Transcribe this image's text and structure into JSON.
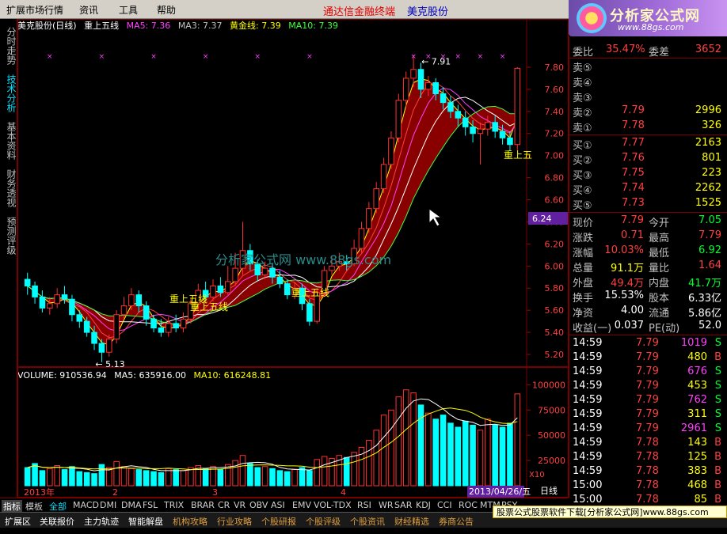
{
  "menu": {
    "items": [
      "扩展市场行情",
      "资讯",
      "工具",
      "帮助"
    ],
    "center_title": "通达信金融终端",
    "center_stock": "美克股份"
  },
  "logo": {
    "main": "分析家公式网",
    "url": "www.88gs.com"
  },
  "vtabs": [
    "分时走势",
    "技术分析",
    "基本资料",
    "财务透视",
    "预测评级"
  ],
  "status": {
    "stock": "美克股份(日线)",
    "formula": "重上五线",
    "ma5": "MA5: 7.36",
    "ma3": "MA3: 7.37",
    "gold": "黄金线: 7.39",
    "ma10": "MA10: 7.39"
  },
  "price_labels": {
    "high": "7.91",
    "low": "5.13",
    "current_tag": "6.24",
    "signal_1": "重上五线",
    "signal_2": "重上五线",
    "signal_3": "重上五线",
    "signal_4": "重上五",
    "watermark": "分析家公式网 www.88gs.com"
  },
  "volume_legend": {
    "volume": "VOLUME: 910536.94",
    "ma5": "MA5: 635916.00",
    "ma10": "MA10: 616248.81"
  },
  "x_axis": {
    "labels": [
      "2013年",
      "2",
      "3",
      "4"
    ],
    "date_tag": "2013/04/26/五",
    "x10": "X10",
    "period": "日线"
  },
  "chart_data": {
    "type": "line",
    "title": "",
    "price_axis": {
      "ticks": [
        7.8,
        7.6,
        7.4,
        7.2,
        7.0,
        6.8,
        6.6,
        6.4,
        6.2,
        6.0,
        5.8,
        5.6,
        5.4,
        5.2
      ],
      "range": [
        5.1,
        7.95
      ]
    },
    "volume_axis": {
      "ticks": [
        100000,
        75000,
        50000,
        25000
      ],
      "range": [
        0,
        105000
      ]
    },
    "candles": [
      [
        5.88,
        5.82,
        5.94,
        5.74
      ],
      [
        5.82,
        5.72,
        5.86,
        5.66
      ],
      [
        5.72,
        5.62,
        5.78,
        5.58
      ],
      [
        5.62,
        5.66,
        5.72,
        5.56
      ],
      [
        5.66,
        5.74,
        5.8,
        5.62
      ],
      [
        5.74,
        5.7,
        5.82,
        5.66
      ],
      [
        5.7,
        5.56,
        5.74,
        5.5
      ],
      [
        5.56,
        5.5,
        5.6,
        5.44
      ],
      [
        5.5,
        5.4,
        5.54,
        5.36
      ],
      [
        5.4,
        5.3,
        5.46,
        5.24
      ],
      [
        5.3,
        5.22,
        5.34,
        5.13
      ],
      [
        5.22,
        5.34,
        5.38,
        5.18
      ],
      [
        5.34,
        5.56,
        5.6,
        5.3
      ],
      [
        5.56,
        5.64,
        5.72,
        5.52
      ],
      [
        5.64,
        5.74,
        5.8,
        5.6
      ],
      [
        5.74,
        5.64,
        5.78,
        5.58
      ],
      [
        5.64,
        5.52,
        5.68,
        5.46
      ],
      [
        5.52,
        5.44,
        5.56,
        5.4
      ],
      [
        5.44,
        5.4,
        5.52,
        5.36
      ],
      [
        5.4,
        5.48,
        5.54,
        5.36
      ],
      [
        5.48,
        5.44,
        5.56,
        5.4
      ],
      [
        5.44,
        5.52,
        5.58,
        5.4
      ],
      [
        5.52,
        5.66,
        5.7,
        5.48
      ],
      [
        5.66,
        5.78,
        5.84,
        5.62
      ],
      [
        5.78,
        5.72,
        5.86,
        5.68
      ],
      [
        5.72,
        5.82,
        5.88,
        5.68
      ],
      [
        5.82,
        5.76,
        5.9,
        5.72
      ],
      [
        5.76,
        5.86,
        6.0,
        5.74
      ],
      [
        5.86,
        5.98,
        6.12,
        5.82
      ],
      [
        5.98,
        6.14,
        6.4,
        5.92
      ],
      [
        6.14,
        6.02,
        6.2,
        5.96
      ],
      [
        6.02,
        5.92,
        6.06,
        5.86
      ],
      [
        5.92,
        5.98,
        6.04,
        5.88
      ],
      [
        5.98,
        5.9,
        6.02,
        5.84
      ],
      [
        5.9,
        5.84,
        5.96,
        5.8
      ],
      [
        5.84,
        5.74,
        5.88,
        5.7
      ],
      [
        5.74,
        5.8,
        5.86,
        5.7
      ],
      [
        5.8,
        5.66,
        5.84,
        5.6
      ],
      [
        5.66,
        5.5,
        5.7,
        5.46
      ],
      [
        5.5,
        5.76,
        5.8,
        5.48
      ],
      [
        5.76,
        5.96,
        6.0,
        5.74
      ],
      [
        5.96,
        6.0,
        6.08,
        5.92
      ],
      [
        6.0,
        6.04,
        6.12,
        5.96
      ],
      [
        6.04,
        6.02,
        6.1,
        5.96
      ],
      [
        6.02,
        6.16,
        6.24,
        6.0
      ],
      [
        6.16,
        6.34,
        6.4,
        6.12
      ],
      [
        6.34,
        6.52,
        6.58,
        6.3
      ],
      [
        6.52,
        6.7,
        6.76,
        6.48
      ],
      [
        6.7,
        6.92,
        6.98,
        6.66
      ],
      [
        6.92,
        7.16,
        7.22,
        6.88
      ],
      [
        7.16,
        7.5,
        7.56,
        7.12
      ],
      [
        7.5,
        7.7,
        7.76,
        7.44
      ],
      [
        7.7,
        7.78,
        7.91,
        7.62
      ],
      [
        7.78,
        7.6,
        7.84,
        7.52
      ],
      [
        7.6,
        7.66,
        7.72,
        7.54
      ],
      [
        7.66,
        7.56,
        7.7,
        7.5
      ],
      [
        7.56,
        7.48,
        7.62,
        7.42
      ],
      [
        7.48,
        7.4,
        7.54,
        7.34
      ],
      [
        7.4,
        7.34,
        7.46,
        7.26
      ],
      [
        7.34,
        7.26,
        7.4,
        7.18
      ],
      [
        7.26,
        7.2,
        7.32,
        7.12
      ],
      [
        7.2,
        7.24,
        7.3,
        6.92
      ],
      [
        7.24,
        7.3,
        7.36,
        7.18
      ],
      [
        7.3,
        7.22,
        7.36,
        7.16
      ],
      [
        7.22,
        7.16,
        7.28,
        7.1
      ],
      [
        7.16,
        7.1,
        7.22,
        7.04
      ],
      [
        7.1,
        7.79,
        7.8,
        7.05
      ]
    ],
    "volume": [
      18000,
      22000,
      15000,
      17000,
      20000,
      16000,
      19000,
      14000,
      13000,
      12000,
      21000,
      18000,
      24000,
      19000,
      17000,
      16000,
      15000,
      14000,
      13000,
      17000,
      16000,
      15000,
      18000,
      20000,
      17000,
      19000,
      16000,
      21000,
      25000,
      30000,
      22000,
      18000,
      19000,
      17000,
      15000,
      14000,
      16000,
      18000,
      15000,
      26000,
      29000,
      27000,
      30000,
      28000,
      33000,
      38000,
      45000,
      55000,
      70000,
      75000,
      88000,
      95000,
      92000,
      80000,
      72000,
      66000,
      70000,
      62000,
      58000,
      64000,
      60000,
      55000,
      66000,
      60000,
      58000,
      62000,
      91000
    ],
    "series": [
      {
        "name": "MA5"
      },
      {
        "name": "MA3"
      },
      {
        "name": "黄金线"
      },
      {
        "name": "MA10"
      }
    ]
  },
  "right_panel": {
    "weibi": {
      "label": "委比",
      "value": "35.47%",
      "label2": "委差",
      "value2": "3652"
    },
    "sells": [
      {
        "label": "卖⑤",
        "price": "",
        "vol": ""
      },
      {
        "label": "卖④",
        "price": "",
        "vol": ""
      },
      {
        "label": "卖③",
        "price": "",
        "vol": ""
      },
      {
        "label": "卖②",
        "price": "7.79",
        "vol": "2996"
      },
      {
        "label": "卖①",
        "price": "7.78",
        "vol": "326"
      }
    ],
    "buys": [
      {
        "label": "买①",
        "price": "7.77",
        "vol": "2163"
      },
      {
        "label": "买②",
        "price": "7.76",
        "vol": "801"
      },
      {
        "label": "买③",
        "price": "7.75",
        "vol": "223"
      },
      {
        "label": "买④",
        "price": "7.74",
        "vol": "2262"
      },
      {
        "label": "买⑤",
        "price": "7.73",
        "vol": "1525"
      }
    ],
    "stats": [
      {
        "l1": "现价",
        "v1": "7.79",
        "c1": "red",
        "l2": "今开",
        "v2": "7.05",
        "c2": "green"
      },
      {
        "l1": "涨跌",
        "v1": "0.71",
        "c1": "red",
        "l2": "最高",
        "v2": "7.79",
        "c2": "red"
      },
      {
        "l1": "涨幅",
        "v1": "10.03%",
        "c1": "red",
        "l2": "最低",
        "v2": "6.92",
        "c2": "green"
      },
      {
        "l1": "总量",
        "v1": "91.1万",
        "c1": "yellow",
        "l2": "量比",
        "v2": "1.64",
        "c2": "red"
      },
      {
        "l1": "外盘",
        "v1": "49.4万",
        "c1": "red",
        "l2": "内盘",
        "v2": "41.7万",
        "c2": "green"
      },
      {
        "l1": "换手",
        "v1": "15.53%",
        "c1": "white",
        "l2": "股本",
        "v2": "6.33亿",
        "c2": "white"
      },
      {
        "l1": "净资",
        "v1": "4.00",
        "c1": "white",
        "l2": "流通",
        "v2": "5.86亿",
        "c2": "white"
      },
      {
        "l1": "收益(一)",
        "v1": "0.037",
        "c1": "white",
        "l2": "PE(动)",
        "v2": "52.0",
        "c2": "white"
      }
    ],
    "ticks": [
      {
        "t": "14:59",
        "p": "7.79",
        "v": "1019",
        "vc": "magenta",
        "s": "S"
      },
      {
        "t": "14:59",
        "p": "7.79",
        "v": "480",
        "vc": "yellow",
        "s": "B"
      },
      {
        "t": "14:59",
        "p": "7.79",
        "v": "676",
        "vc": "magenta",
        "s": "S"
      },
      {
        "t": "14:59",
        "p": "7.79",
        "v": "453",
        "vc": "yellow",
        "s": "S"
      },
      {
        "t": "14:59",
        "p": "7.79",
        "v": "762",
        "vc": "magenta",
        "s": "S"
      },
      {
        "t": "14:59",
        "p": "7.79",
        "v": "311",
        "vc": "yellow",
        "s": "S"
      },
      {
        "t": "14:59",
        "p": "7.79",
        "v": "2961",
        "vc": "magenta",
        "s": "S"
      },
      {
        "t": "14:59",
        "p": "7.78",
        "v": "143",
        "vc": "yellow",
        "s": "B"
      },
      {
        "t": "14:59",
        "p": "7.78",
        "v": "125",
        "vc": "yellow",
        "s": "B"
      },
      {
        "t": "14:59",
        "p": "7.78",
        "v": "383",
        "vc": "yellow",
        "s": "B"
      },
      {
        "t": "15:00",
        "p": "7.78",
        "v": "468",
        "vc": "yellow",
        "s": "B"
      },
      {
        "t": "15:00",
        "p": "7.78",
        "v": "85",
        "vc": "yellow",
        "s": "B"
      }
    ]
  },
  "indicator_tabs": [
    "指标",
    "模板",
    "全部",
    "MACD",
    "DMI",
    "DMA",
    "FSL",
    "TRIX",
    "BRAR",
    "CR",
    "VR",
    "OBV",
    "ASI",
    "EMV",
    "VOL-TDX",
    "RSI",
    "WR",
    "SAR",
    "KDJ",
    "CCI",
    "ROC",
    "MTM",
    "PSY"
  ],
  "bottom_tabs": [
    "扩展区",
    "关联报价",
    "主力轨迹",
    "智能解盘",
    "机构攻略",
    "行业攻略",
    "个股研报",
    "个股评级",
    "个股资讯",
    "财经精选",
    "券商公告"
  ],
  "ad_text": "股票公式股票软件下载[分析家公式网]www.88gs.com",
  "colors": {
    "up": "#ff3030",
    "down": "#00ffff",
    "ma_yellow": "#ffff00",
    "ribbon": "#a00000",
    "panel_border": "#7a0000",
    "ma_green": "#40ff40",
    "ma_white": "#ffffff"
  }
}
